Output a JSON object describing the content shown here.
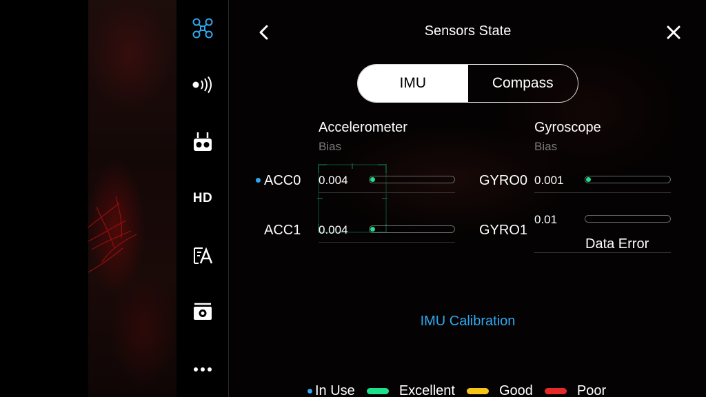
{
  "header": {
    "title": "Sensors State"
  },
  "tabs": [
    {
      "label": "IMU",
      "active": true
    },
    {
      "label": "Compass",
      "active": false
    }
  ],
  "accelerometer": {
    "title": "Accelerometer",
    "subtitle": "Bias",
    "rows": [
      {
        "label": "ACC0",
        "value": "0.004",
        "in_use": true,
        "level": 0.04
      },
      {
        "label": "ACC1",
        "value": "0.004",
        "in_use": false,
        "level": 0.04
      }
    ]
  },
  "gyroscope": {
    "title": "Gyroscope",
    "subtitle": "Bias",
    "rows": [
      {
        "label": "GYRO0",
        "value": "0.001",
        "in_use": false,
        "level": 0.03
      },
      {
        "label": "GYRO1",
        "value": "0.01",
        "in_use": false,
        "level": 0,
        "status": "Data Error"
      }
    ]
  },
  "calibration": {
    "label": "IMU Calibration"
  },
  "reticle": {
    "label": "AF"
  },
  "legend": {
    "in_use": "In Use",
    "excellent": "Excellent",
    "good": "Good",
    "poor": "Poor"
  },
  "sidebar": {
    "items": [
      {
        "name": "aircraft-icon",
        "active": true
      },
      {
        "name": "signal-icon",
        "active": false
      },
      {
        "name": "remote-controller-icon",
        "active": false
      },
      {
        "name": "hd-transmission",
        "label": "HD",
        "active": false
      },
      {
        "name": "visual-navigation-icon",
        "active": false
      },
      {
        "name": "camera-icon",
        "active": false
      },
      {
        "name": "more-icon",
        "active": false
      }
    ]
  },
  "colors": {
    "accent": "#2fa8f0",
    "excellent": "#1ee08a",
    "good": "#f5c518",
    "poor": "#e52a2a"
  }
}
